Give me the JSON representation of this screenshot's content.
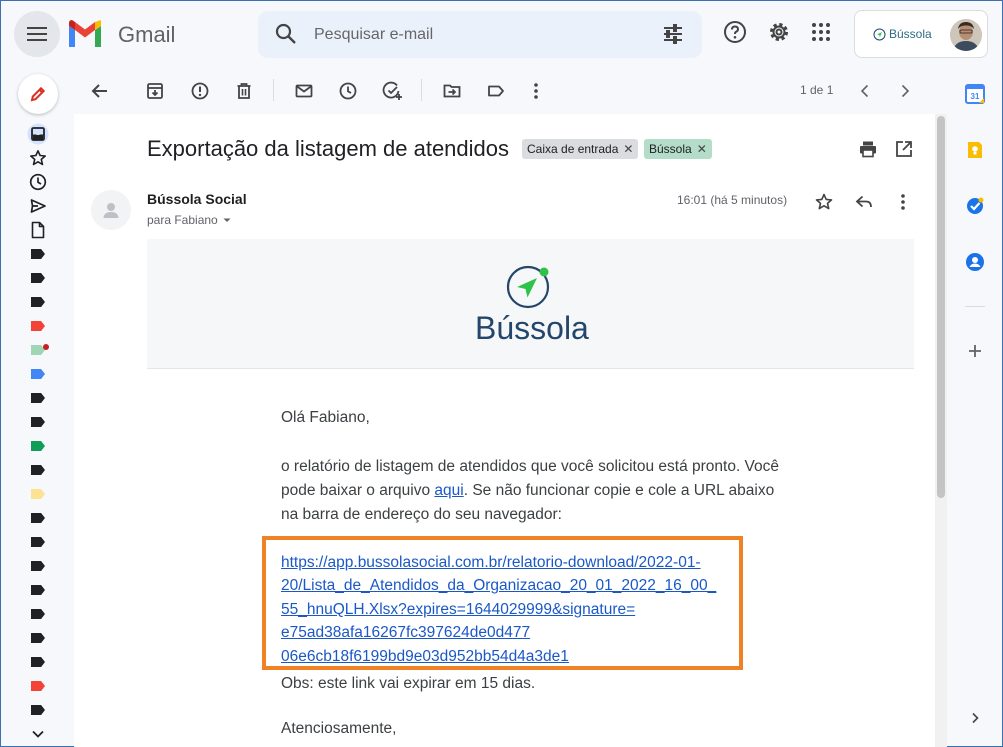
{
  "header": {
    "app_name": "Gmail",
    "search_placeholder": "Pesquisar e-mail",
    "account_brand": "Bússola"
  },
  "toolbar": {
    "pager": "1 de 1"
  },
  "message": {
    "subject": "Exportação da listagem de atendidos",
    "labels": [
      {
        "name": "Caixa de entrada",
        "color": "#dadce0"
      },
      {
        "name": "Bússola",
        "color": "#b3dcc9"
      }
    ],
    "sender": "Bússola Social",
    "recipient": "para Fabiano",
    "time": "16:01 (há 5 minutos)",
    "banner_brand": "Bússola",
    "greeting": "Olá Fabiano,",
    "paragraph_before_link": "o relatório de listagem de atendidos que você solicitou está pronto. Você pode baixar o arquivo ",
    "link_text": "aqui",
    "paragraph_after_link": ". Se não funcionar copie e cole a URL abaixo na barra de endereço do seu navegador:",
    "url": "https://app.bussolasocial.com.br/relatorio-download/2022-01-20/Lista_de_Atendidos_da_Organizacao_20_01_2022_16_00_55_hnuQLH.Xlsx?expires=1644029999&signature=e75ad38afa16267fc397624de0d47706e6cb18f6199bd9e03d952bb54d4a3de1",
    "url_lines": [
      "https://app.bussolasocial.com.br/relatorio-download/2022-01-",
      "20/Lista_de_Atendidos_da_Organizacao_20_01_2022_16_00_",
      "55_hnuQLH.Xlsx?expires=1644029999&signature=",
      "e75ad38afa16267fc397624de0d477",
      "06e6cb18f6199bd9e03d952bb54d4a3de1"
    ],
    "note": "Obs: este link vai expirar em 15 dias.",
    "closing": "Atenciosamente,"
  },
  "side_panel": {
    "calendar_day": "31"
  },
  "colors": {
    "highlight_border": "#f08226",
    "link": "#1a58c8",
    "brand_green": "#2ec24a",
    "brand_navy": "#24466b"
  },
  "rail_labels": [
    "#202124",
    "#202124",
    "#202124",
    "#f44336",
    "#9fd6b3",
    "#4285f4",
    "#202124",
    "#202124",
    "#0f9d58",
    "#202124",
    "#fde293",
    "#202124",
    "#202124",
    "#202124",
    "#202124",
    "#202124",
    "#202124",
    "#202124",
    "#f44336",
    "#202124"
  ]
}
